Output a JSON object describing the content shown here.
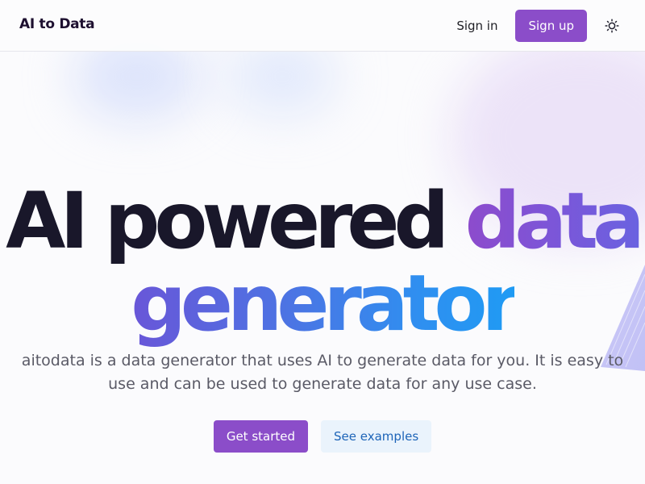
{
  "header": {
    "brand": "AI to Data",
    "sign_in_label": "Sign in",
    "sign_up_label": "Sign up",
    "theme_icon": "sun-icon"
  },
  "hero": {
    "title_dark": "AI powered",
    "title_accent_1": "data",
    "title_accent_2": "generator",
    "description": "aitodata is a data generator that uses AI to generate data for you. It is easy to use and can be used to generate data for any use case."
  },
  "cta": {
    "primary_label": "Get started",
    "secondary_label": "See examples"
  },
  "colors": {
    "brand_purple": "#8b4dc9",
    "title_dark": "#19172a",
    "accent_blue": "#1f9bf4",
    "secondary_button_bg": "#eaf3fc",
    "secondary_button_text": "#1d64b8"
  }
}
